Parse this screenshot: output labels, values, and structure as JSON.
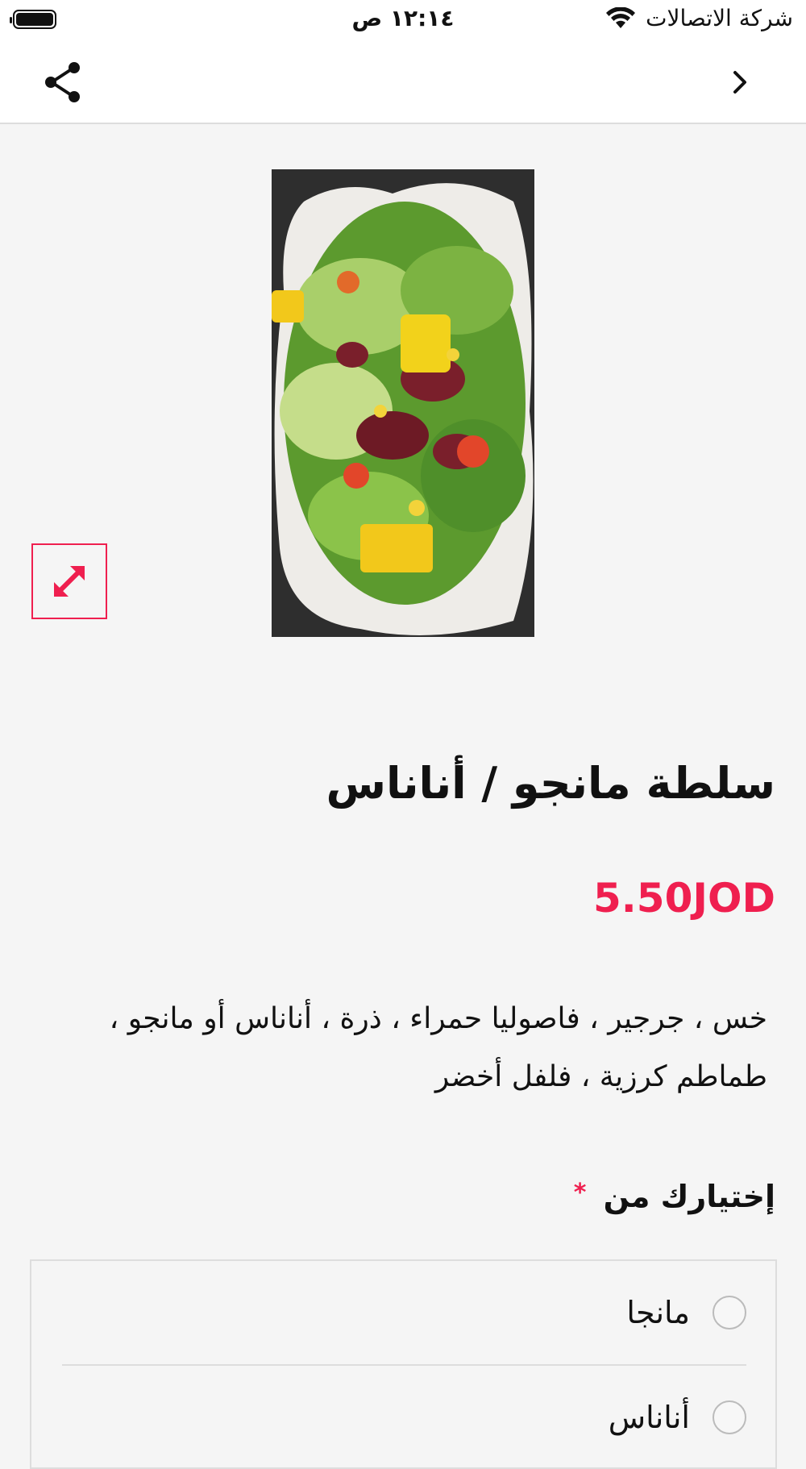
{
  "status_bar": {
    "carrier": "شركة الاتصالات",
    "time": "١٢:١٤ ص"
  },
  "nav": {
    "share_icon": "share-icon",
    "back_icon": "chevron-right-icon"
  },
  "product": {
    "image_alt": "salad-photo",
    "expand_icon": "expand-icon",
    "title": "سلطة مانجو / أناناس",
    "price": "5.50JOD",
    "description": "خس ، جرجير ، فاصوليا حمراء ، ذرة ، أناناس أو مانجو ، طماطم كرزية ، فلفل أخضر"
  },
  "options": {
    "heading": "إختيارك من",
    "required_mark": "*",
    "items": [
      {
        "label": "مانجا"
      },
      {
        "label": "أناناس"
      }
    ]
  },
  "colors": {
    "accent": "#ef1f4f",
    "background": "#f5f5f5"
  }
}
